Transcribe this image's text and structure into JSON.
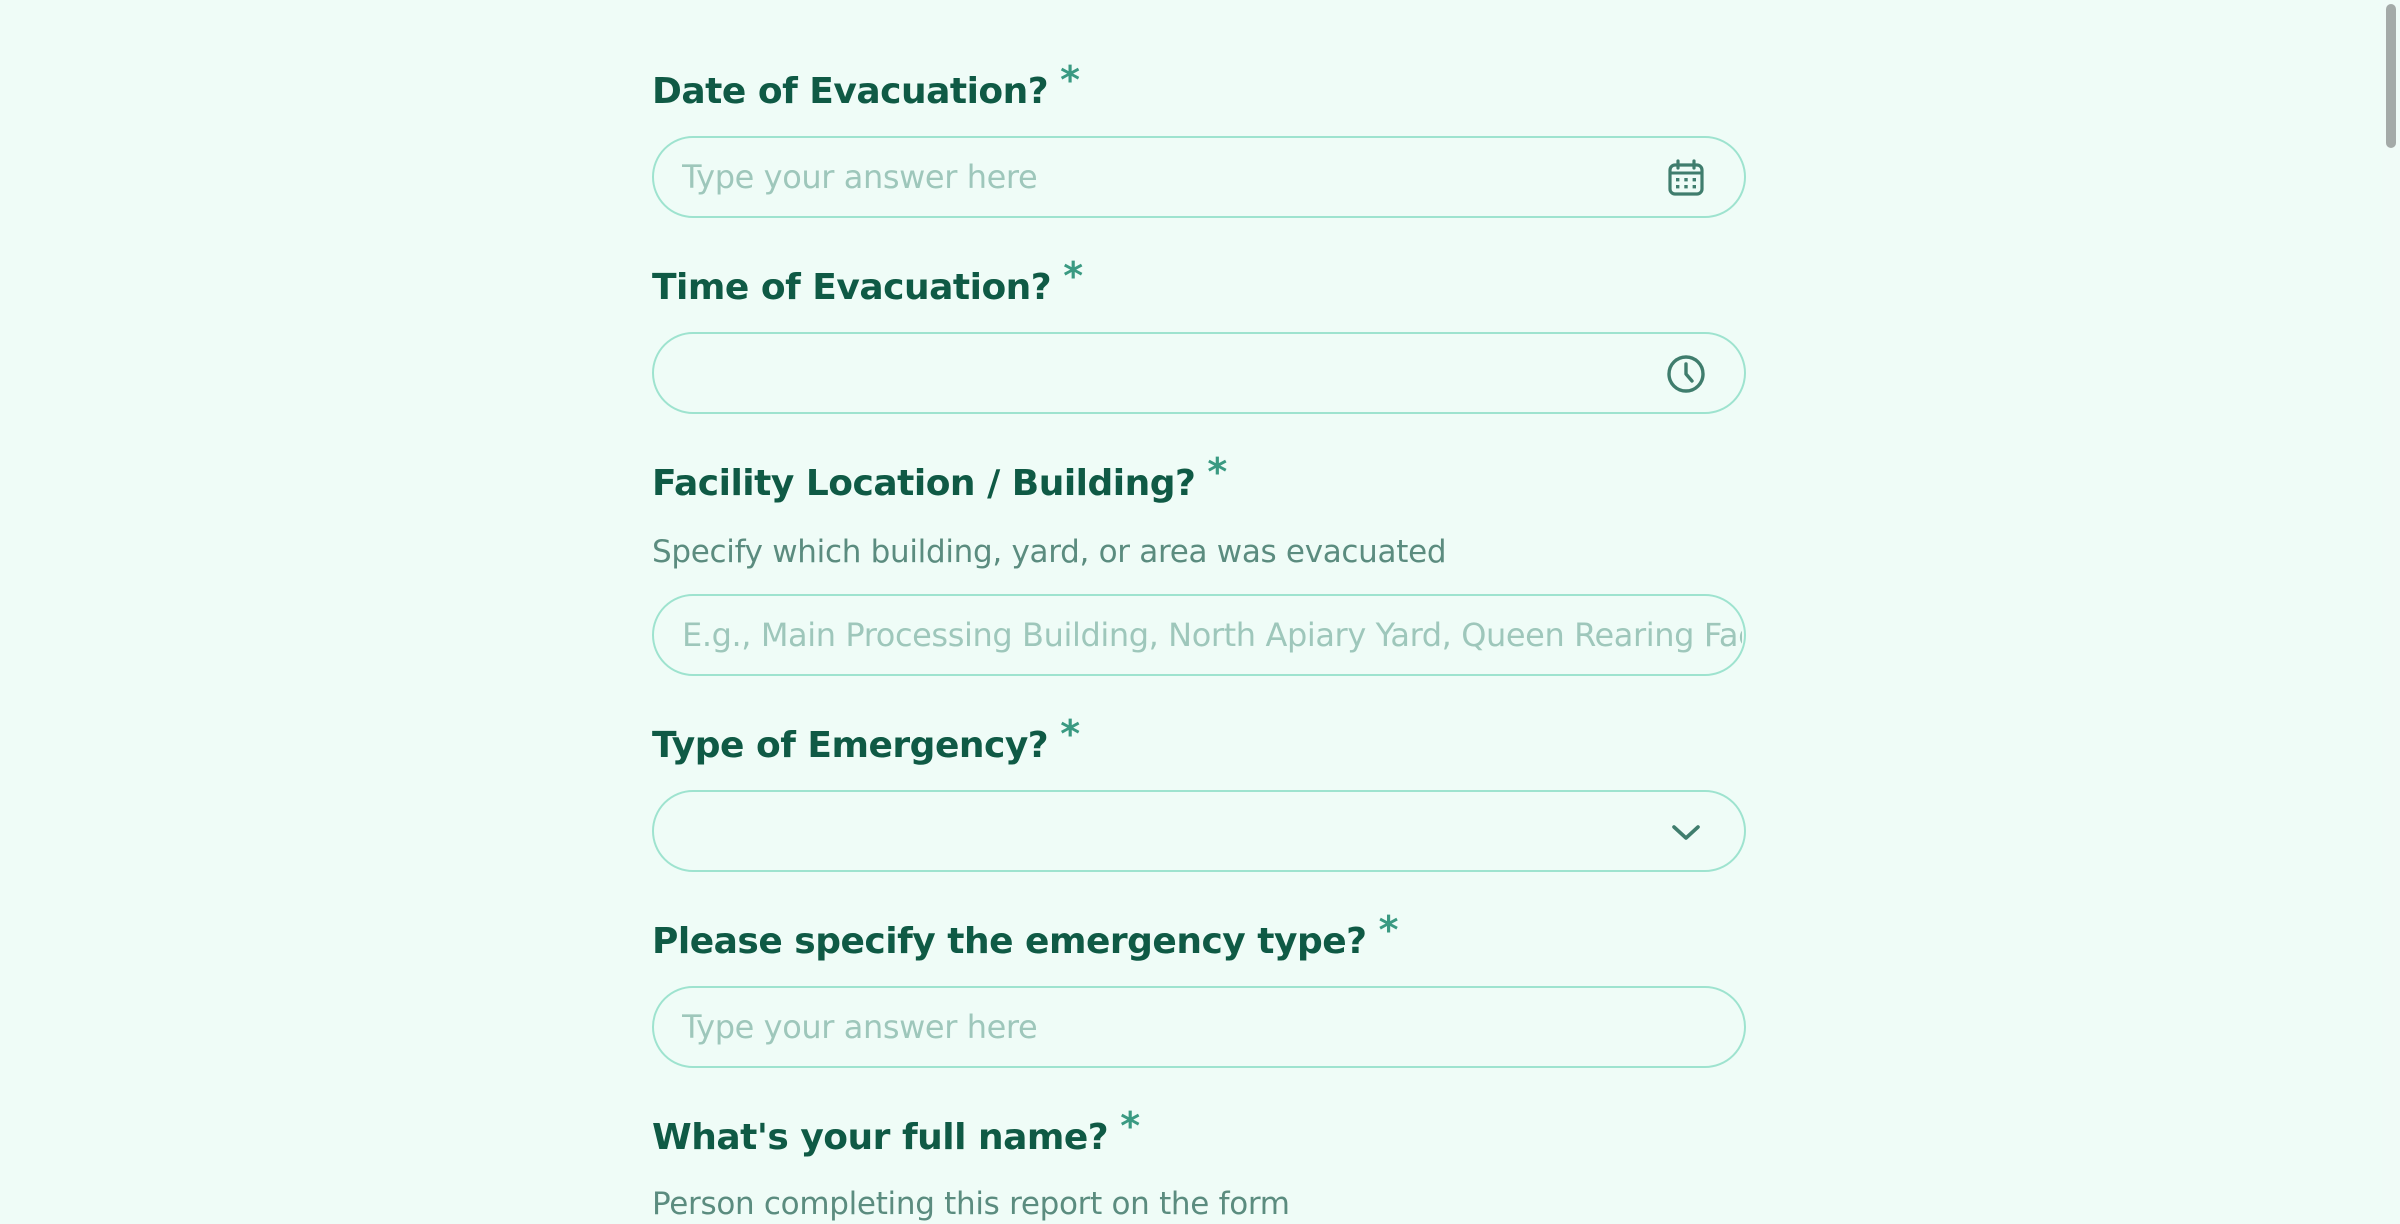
{
  "questions": [
    {
      "label": "Date of Evacuation?",
      "required_mark": "*",
      "placeholder": "Type your answer here",
      "value": "",
      "icon": "calendar-icon"
    },
    {
      "label": "Time of Evacuation?",
      "required_mark": "*",
      "placeholder": "",
      "value": "",
      "icon": "clock-icon"
    },
    {
      "label": "Facility Location / Building?",
      "required_mark": "*",
      "help": "Specify which building, yard, or area was evacuated",
      "placeholder": "E.g., Main Processing Building, North Apiary Yard, Queen Rearing Facility",
      "value": ""
    },
    {
      "label": "Type of Emergency?",
      "required_mark": "*",
      "selected": "",
      "icon": "chevron-down-icon"
    },
    {
      "label": "Please specify the emergency type?",
      "required_mark": "*",
      "placeholder": "Type your answer here",
      "value": ""
    },
    {
      "label": "What's your full name?",
      "required_mark": "*",
      "help": "Person completing this report on the form"
    }
  ],
  "colors": {
    "background": "#effcf7",
    "label": "#0f5a45",
    "accent": "#3a9a82",
    "border": "#9ee3cf",
    "placeholder": "#9ec7bb"
  }
}
